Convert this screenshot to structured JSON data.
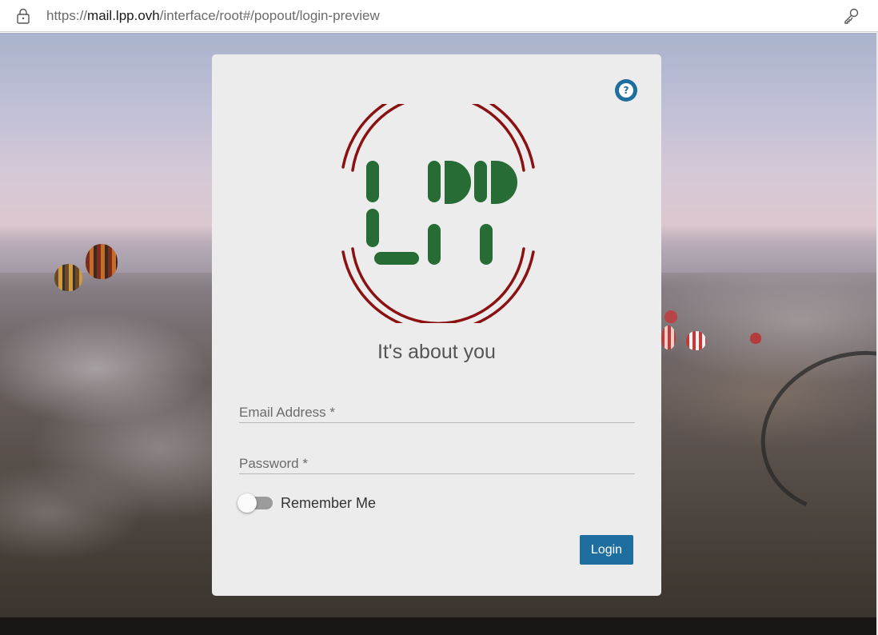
{
  "browser": {
    "url_scheme": "https://",
    "url_host": "mail.lpp.ovh",
    "url_path": "/interface/root#/popout/login-preview",
    "lock_icon": "lock-icon",
    "key_icon": "key-icon"
  },
  "login": {
    "help_icon": "help-icon",
    "help_symbol": "?",
    "logo": {
      "text": "LPP",
      "colors": {
        "ring": "#8b1212",
        "letters": "#276b35"
      }
    },
    "tagline": "It's about you",
    "email_placeholder": "Email Address *",
    "password_placeholder": "Password *",
    "remember_label": "Remember Me",
    "remember_checked": false,
    "login_button": "Login"
  },
  "colors": {
    "accent": "#1e6e9f",
    "card_bg": "#ececec"
  }
}
